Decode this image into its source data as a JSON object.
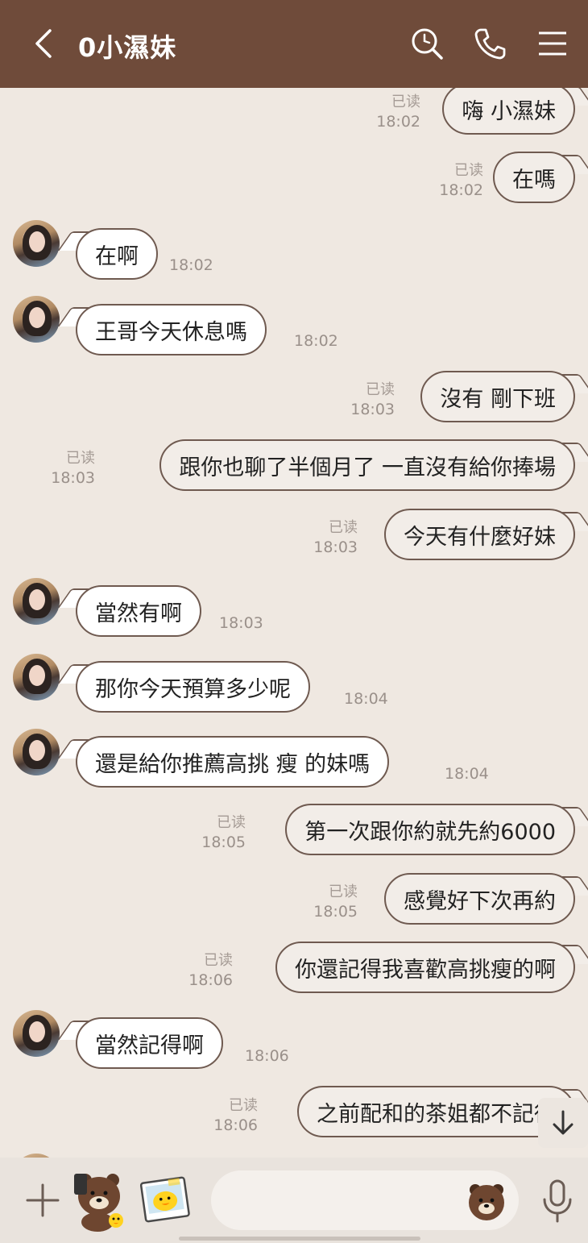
{
  "header": {
    "title": "0小濕妹",
    "back_icon": "chevron-left-icon",
    "search_icon": "search-icon",
    "call_icon": "phone-icon",
    "menu_icon": "menu-icon"
  },
  "colors": {
    "header_bg": "#6f4b3a",
    "chat_bg": "#efe8e1",
    "bubble_border": "#6f5a50"
  },
  "messages": [
    {
      "dir": "out",
      "text": "嗨  小濕妹",
      "read": "已读",
      "time": "18:02"
    },
    {
      "dir": "out",
      "text": "在嗎",
      "read": "已读",
      "time": "18:02"
    },
    {
      "dir": "in",
      "text": "在啊",
      "time": "18:02"
    },
    {
      "dir": "in",
      "text": "王哥今天休息嗎",
      "time": "18:02"
    },
    {
      "dir": "out",
      "text": "沒有  剛下班",
      "read": "已读",
      "time": "18:03"
    },
    {
      "dir": "out",
      "text": "跟你也聊了半個月了  一直沒有給你捧場",
      "read": "已读",
      "time": "18:03"
    },
    {
      "dir": "out",
      "text": "今天有什麼好妹",
      "read": "已读",
      "time": "18:03"
    },
    {
      "dir": "in",
      "text": "當然有啊",
      "time": "18:03"
    },
    {
      "dir": "in",
      "text": "那你今天預算多少呢",
      "time": "18:04"
    },
    {
      "dir": "in",
      "text": "還是給你推薦高挑  瘦  的妹嗎",
      "time": "18:04"
    },
    {
      "dir": "out",
      "text": "第一次跟你約就先約6000",
      "read": "已读",
      "time": "18:05"
    },
    {
      "dir": "out",
      "text": "感覺好下次再約",
      "read": "已读",
      "time": "18:05"
    },
    {
      "dir": "out",
      "text": "你還記得我喜歡高挑瘦的啊",
      "read": "已读",
      "time": "18:06"
    },
    {
      "dir": "in",
      "text": "當然記得啊",
      "time": "18:06"
    },
    {
      "dir": "out",
      "text": "之前配和的茶姐都不記得",
      "read": "已读",
      "time": "18:06"
    }
  ],
  "composer": {
    "plus_icon": "plus-icon",
    "sticker_icon": "bear-sticker-icon",
    "photo_icon": "sticker-photo-icon",
    "emoji_icon": "bear-emoji-icon",
    "mic_icon": "microphone-icon",
    "scroll_down_icon": "arrow-down-icon"
  }
}
